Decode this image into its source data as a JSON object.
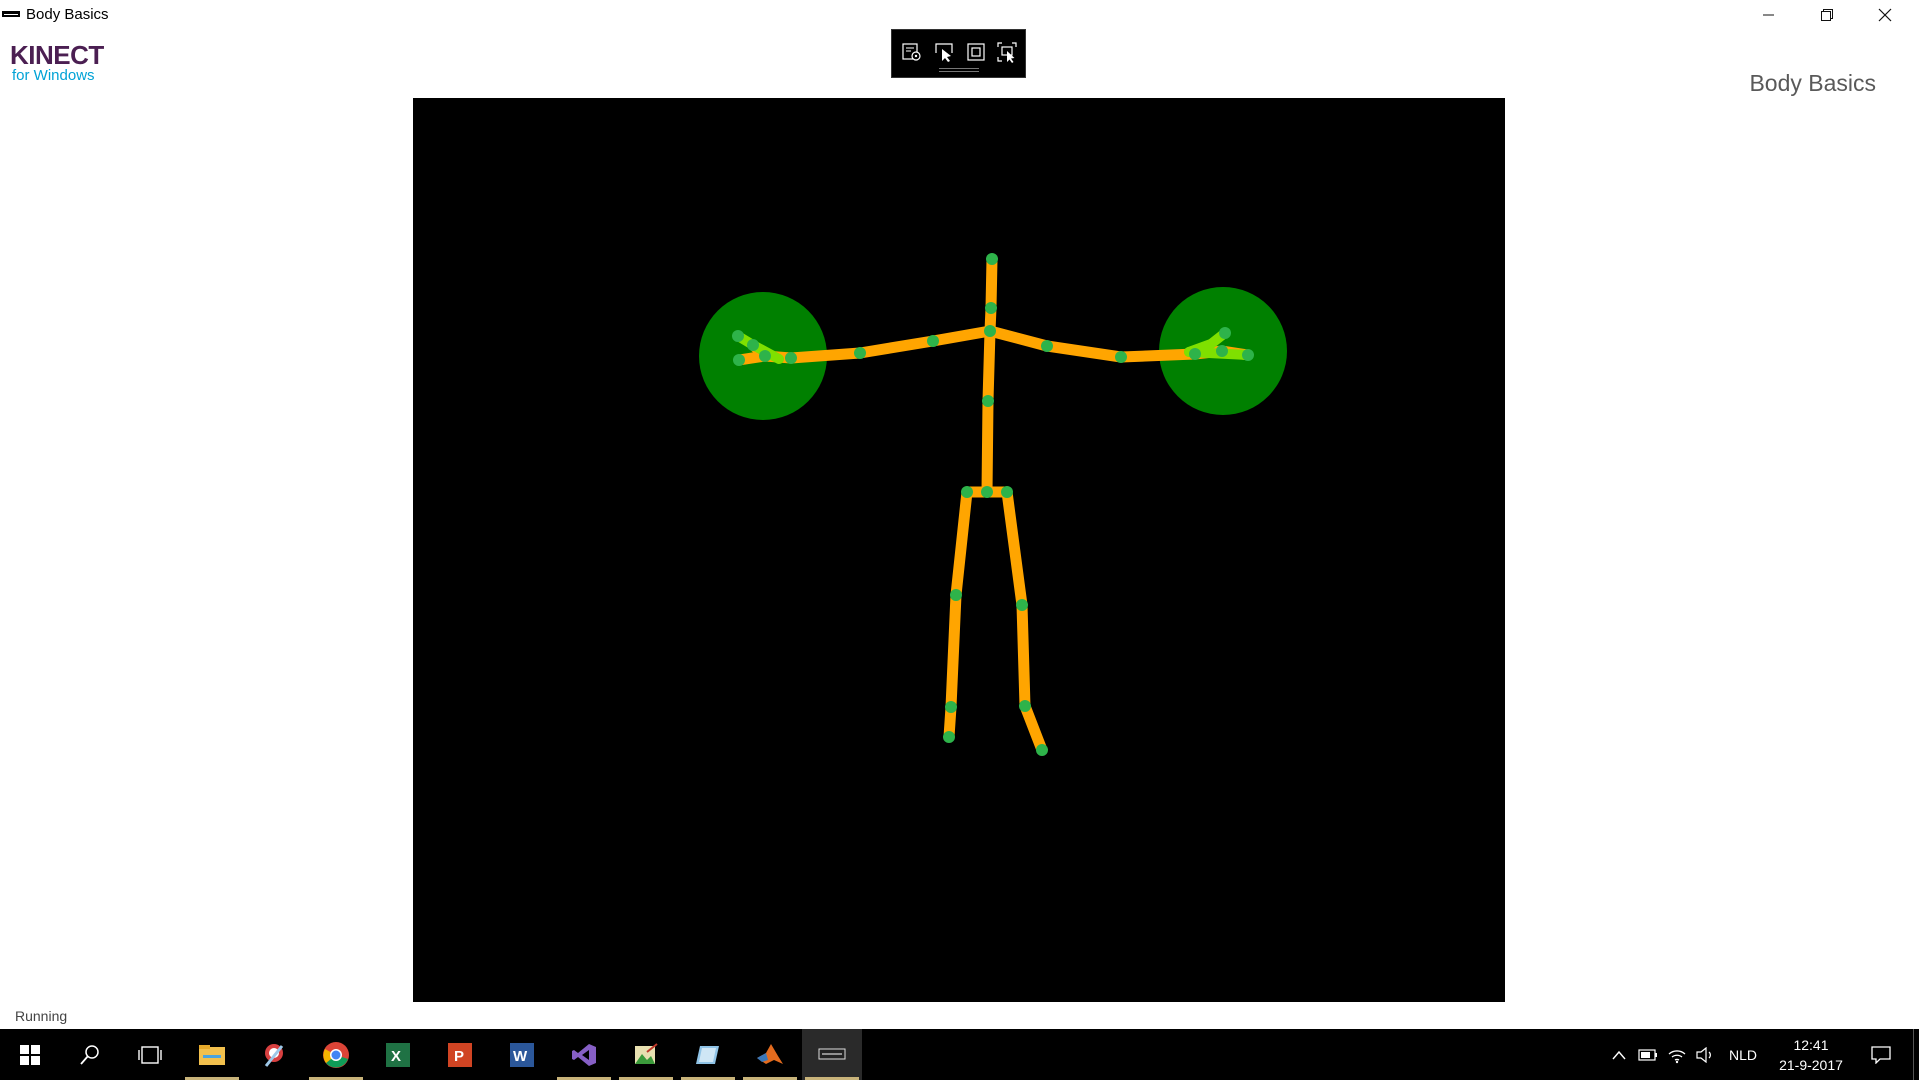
{
  "window": {
    "title": "Body Basics",
    "buttons": {
      "minimize_icon": "minimize-icon",
      "restore_icon": "restore-icon",
      "close_icon": "close-icon"
    }
  },
  "header": {
    "logo_main": "KINECT",
    "logo_sub": "for Windows",
    "title": "Body Basics"
  },
  "debug_toolbar": {
    "buttons": [
      "live-visual-tree-icon",
      "select-element-icon",
      "display-layout-adorners-icon",
      "track-focused-element-icon"
    ]
  },
  "body_view": {
    "background": "#000000",
    "bone_color": "#ffa500",
    "joint_color": "#2eb34a",
    "hand_state_color": "#008000",
    "hand_state": {
      "left": "open",
      "right": "open"
    }
  },
  "status": {
    "text": "Running"
  },
  "taskbar": {
    "apps": [
      "start-icon",
      "search-icon",
      "task-view-icon",
      "file-explorer-icon",
      "snipping-tool-icon",
      "chrome-icon",
      "excel-icon",
      "powerpoint-icon",
      "word-icon",
      "visual-studio-icon",
      "image-editor-icon",
      "reader-icon",
      "matlab-icon",
      "console-app-icon"
    ],
    "tray": {
      "language": "NLD",
      "time": "12:41",
      "date": "21-9-2017"
    }
  }
}
